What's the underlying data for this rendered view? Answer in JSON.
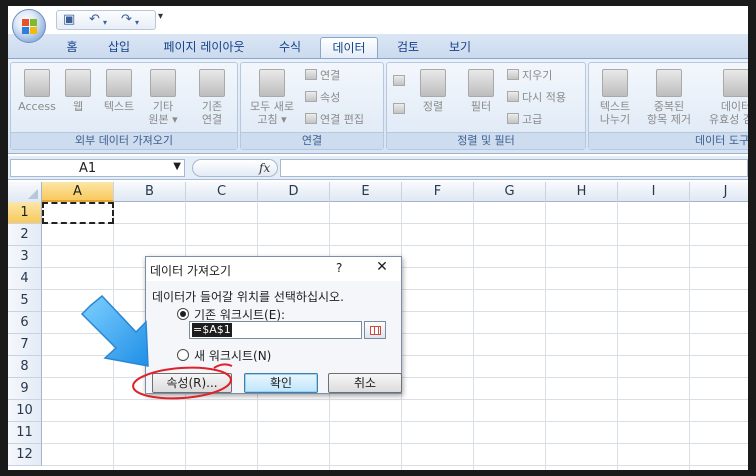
{
  "ribbon": {
    "tabs": [
      {
        "label": "홈",
        "active": false
      },
      {
        "label": "삽입",
        "active": false
      },
      {
        "label": "페이지 레이아웃",
        "active": false
      },
      {
        "label": "수식",
        "active": false
      },
      {
        "label": "데이터",
        "active": true
      },
      {
        "label": "검토",
        "active": false
      },
      {
        "label": "보기",
        "active": false
      }
    ],
    "groups": {
      "external": {
        "label": "외부 데이터 가져오기",
        "buttons": [
          {
            "line1": "Access",
            "line2": ""
          },
          {
            "line1": "웹",
            "line2": ""
          },
          {
            "line1": "텍스트",
            "line2": ""
          },
          {
            "line1": "기타",
            "line2": "원본 ▾"
          },
          {
            "line1": "기존",
            "line2": "연결"
          }
        ]
      },
      "connections": {
        "label": "연결",
        "refresh": {
          "line1": "모두 새로",
          "line2": "고침 ▾"
        },
        "items": [
          "연결",
          "속성",
          "연결 편집"
        ]
      },
      "sort": {
        "label": "정렬 및 필터",
        "sort_label": "정렬",
        "filter_label": "필터",
        "items": [
          "지우기",
          "다시 적용",
          "고급"
        ]
      },
      "tools": {
        "label": "데이터 도구",
        "buttons": [
          {
            "line1": "텍스트",
            "line2": "나누기"
          },
          {
            "line1": "중복된",
            "line2": "항목 제거"
          },
          {
            "line1": "데이터",
            "line2": "유효성 검사"
          }
        ]
      }
    }
  },
  "formula_bar": {
    "name_box": "A1",
    "fx": "fx",
    "formula": ""
  },
  "grid": {
    "columns": [
      "A",
      "B",
      "C",
      "D",
      "E",
      "F",
      "G",
      "H",
      "I",
      "J"
    ],
    "rows": [
      "1",
      "2",
      "3",
      "4",
      "5",
      "6",
      "7",
      "8",
      "9",
      "10",
      "11",
      "12"
    ],
    "selected_cell": "A1"
  },
  "dialog": {
    "title": "데이터 가져오기",
    "help": "?",
    "close": "✕",
    "prompt": "데이터가 들어갈 위치를 선택하십시오.",
    "option_existing": "기존 워크시트(E):",
    "option_existing_selected": true,
    "reference": "=$A$1",
    "option_new": "새 워크시트(N)",
    "option_new_selected": false,
    "buttons": {
      "properties": "속성(R)...",
      "ok": "확인",
      "cancel": "취소"
    }
  },
  "colors": {
    "accent": "#15428b",
    "annotation_arrow": "#3aa3f0",
    "annotation_circle": "#e0202a"
  }
}
